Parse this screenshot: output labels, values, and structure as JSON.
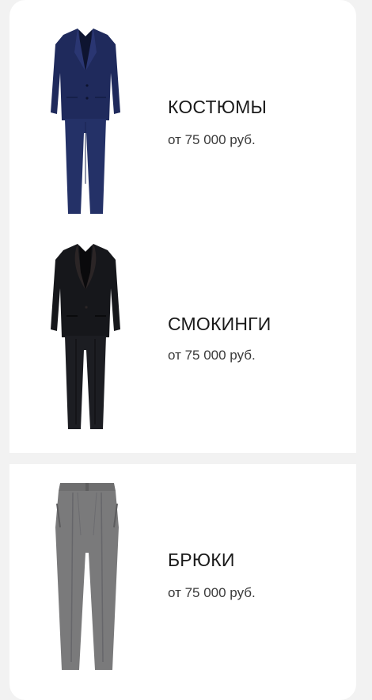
{
  "products": [
    {
      "title": "КОСТЮМЫ",
      "price": "от 75 000 руб.",
      "image": "navy-suit-image"
    },
    {
      "title": "СМОКИНГИ",
      "price": "от 75 000 руб.",
      "image": "black-tuxedo-image"
    },
    {
      "title": "БРЮКИ",
      "price": "от 75 000 руб.",
      "image": "grey-trousers-image"
    }
  ],
  "colors": {
    "background": "#f2f2f2",
    "card": "#ffffff",
    "title": "#1a1a1a",
    "price": "#3a3a3a",
    "suit_navy": "#1f2a5c",
    "tuxedo_black": "#16171b",
    "trousers_grey": "#7a7a7b"
  }
}
